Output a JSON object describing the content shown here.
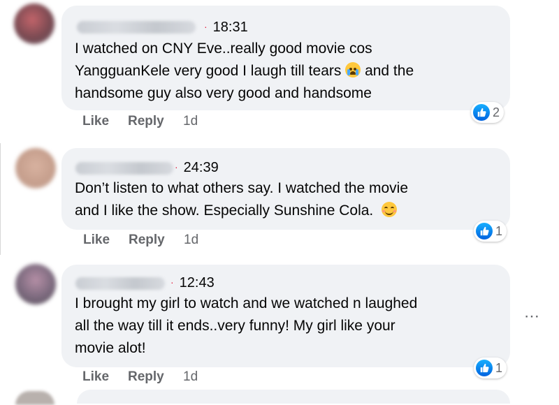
{
  "comments": [
    {
      "time": "18:31",
      "text_lines": [
        "I watched on CNY Eve..really good movie cos",
        "YangguanKele very good I laugh till tears",
        "and the",
        "handsome guy also very good and handsome"
      ],
      "emoji": "loudly-crying-face",
      "actions": {
        "like": "Like",
        "reply": "Reply",
        "age": "1d"
      },
      "reaction_count": "2"
    },
    {
      "time": "24:39",
      "text_lines": [
        "Don’t listen to what others say. I watched the movie",
        "and I like the show. Especially Sunshine Cola."
      ],
      "emoji": "smiling-face",
      "actions": {
        "like": "Like",
        "reply": "Reply",
        "age": "1d"
      },
      "reaction_count": "1"
    },
    {
      "time": "12:43",
      "text_lines": [
        "I brought my girl to watch and we watched n laughed",
        "all the way till it ends..very funny! My girl like your",
        "movie alot!"
      ],
      "actions": {
        "like": "Like",
        "reply": "Reply",
        "age": "1d"
      },
      "reaction_count": "1"
    }
  ],
  "more_options_icon": "⋯",
  "colors": {
    "bubble": "#f0f2f5",
    "like_blue": "#0866ff",
    "muted": "#65676b",
    "time_dot": "#e41e3f"
  }
}
